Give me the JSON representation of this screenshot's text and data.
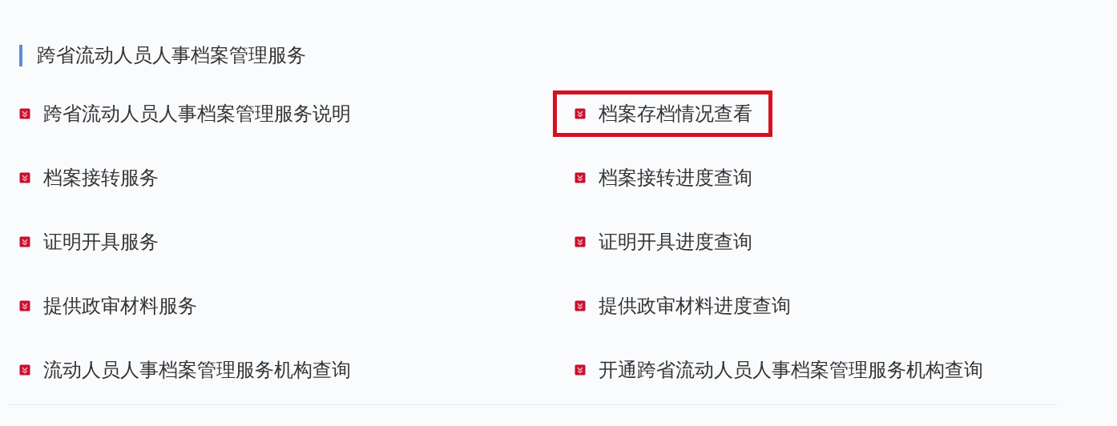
{
  "section": {
    "title": "跨省流动人员人事档案管理服务"
  },
  "links": [
    {
      "label": "跨省流动人员人事档案管理服务说明",
      "highlighted": false
    },
    {
      "label": "档案存档情况查看",
      "highlighted": true
    },
    {
      "label": "档案接转服务",
      "highlighted": false
    },
    {
      "label": "档案接转进度查询",
      "highlighted": false
    },
    {
      "label": "证明开具服务",
      "highlighted": false
    },
    {
      "label": "证明开具进度查询",
      "highlighted": false
    },
    {
      "label": "提供政审材料服务",
      "highlighted": false
    },
    {
      "label": "提供政审材料进度查询",
      "highlighted": false
    },
    {
      "label": "流动人员人事档案管理服务机构查询",
      "highlighted": false
    },
    {
      "label": "开通跨省流动人员人事档案管理服务机构查询",
      "highlighted": false
    }
  ]
}
